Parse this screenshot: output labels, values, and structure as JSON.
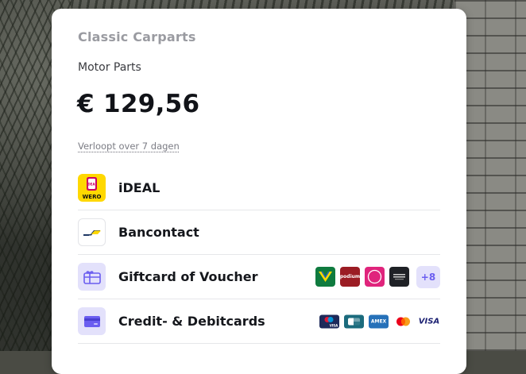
{
  "merchant": {
    "name": "Classic Carparts"
  },
  "payment": {
    "description": "Motor Parts",
    "amount": "€ 129,56",
    "expiry": "Verloopt over 7 dagen"
  },
  "methods": [
    {
      "label": "iDEAL",
      "icon": "ideal-wero-logo",
      "logo_text_top": "iDEAL",
      "logo_text_bottom": "WERO"
    },
    {
      "label": "Bancontact",
      "icon": "bancontact-logo"
    },
    {
      "label": "Giftcard of Voucher",
      "icon": "giftcard-icon",
      "brands": [
        {
          "icon": "vvv-giftcard-logo",
          "text": "VVV",
          "color": "#0f7b3f"
        },
        {
          "icon": "podium-giftcard-logo",
          "text": "podium",
          "color": "#9b1c24"
        },
        {
          "icon": "fashioncheque-logo",
          "text": "FC",
          "color": "#e0247c"
        },
        {
          "icon": "nationale-bioscoopbon-logo",
          "text": "BON",
          "color": "#1f2126"
        }
      ],
      "more_label": "+8"
    },
    {
      "label": "Credit- & Debitcards",
      "icon": "credit-card-icon",
      "brands": [
        {
          "icon": "maestro-visa-logo",
          "text": "VISA",
          "color": "#1e2a5a"
        },
        {
          "icon": "cartes-bancaires-logo",
          "text": "CB",
          "color": "#1b6b7d"
        },
        {
          "icon": "amex-logo",
          "text": "AMEX",
          "color": "#2671b9"
        },
        {
          "icon": "mastercard-logo",
          "text": "",
          "color": "#ffffff"
        },
        {
          "icon": "visa-logo",
          "text": "VISA",
          "color": "#ffffff"
        }
      ]
    }
  ],
  "colors": {
    "accent": "#6b5ef0",
    "accent_soft": "#e3e1fb",
    "ideal_yellow": "#ffd800",
    "bancontact_blue": "#1e3764",
    "bancontact_yellow": "#ffd800",
    "title_gray": "#9a9ba1"
  }
}
